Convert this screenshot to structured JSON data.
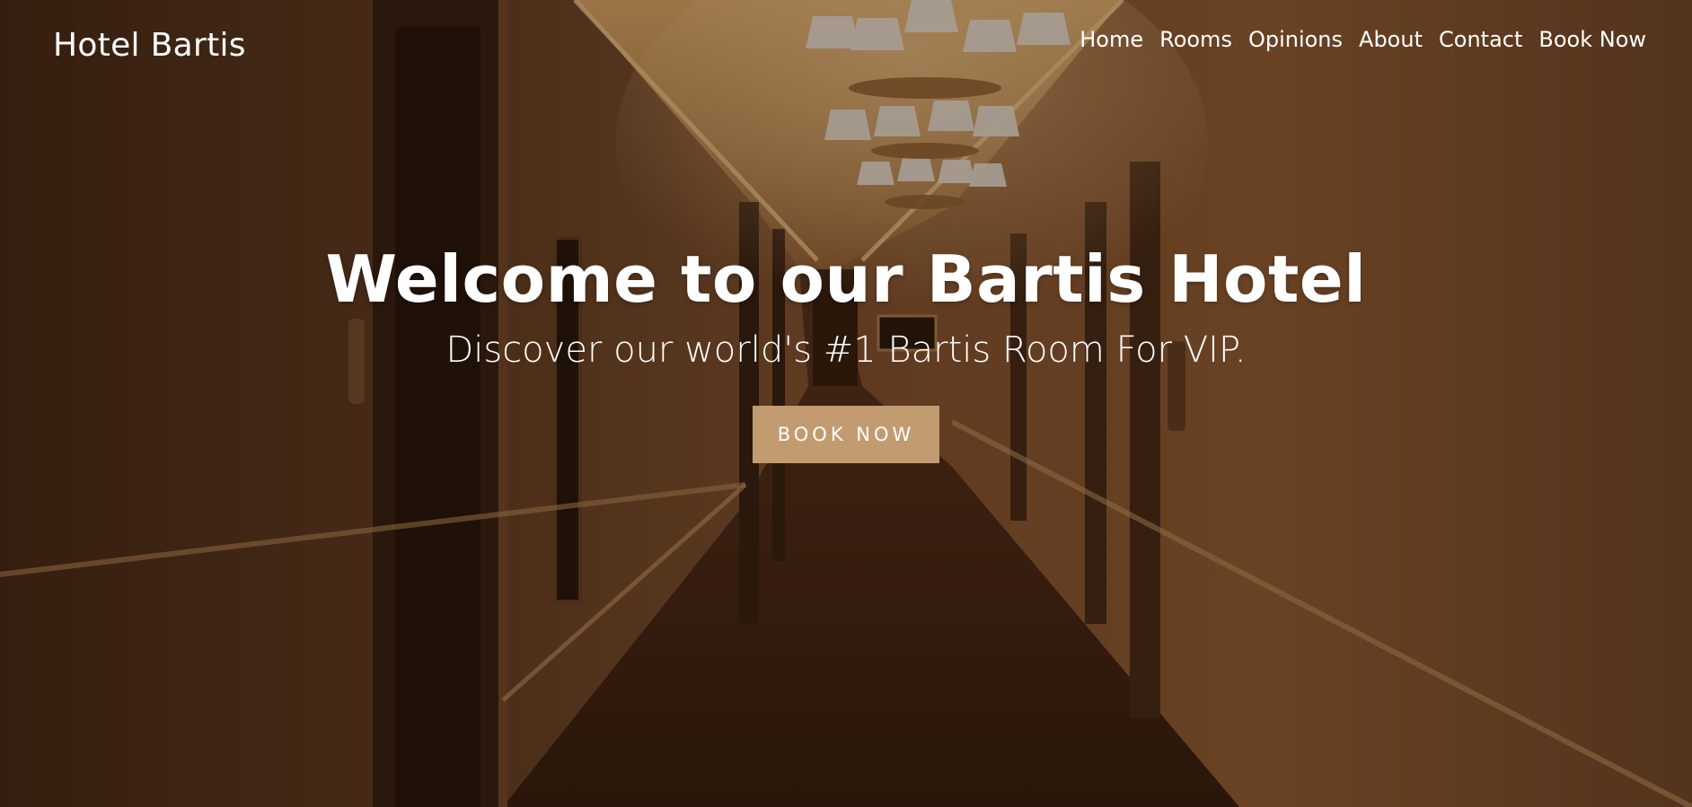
{
  "site": {
    "brand": "Hotel Bartis"
  },
  "nav": {
    "items": [
      {
        "label": "Home"
      },
      {
        "label": "Rooms"
      },
      {
        "label": "Opinions"
      },
      {
        "label": "About"
      },
      {
        "label": "Contact"
      },
      {
        "label": "Book Now"
      }
    ]
  },
  "hero": {
    "title": "Welcome to our Bartis Hotel",
    "subtitle": "Discover our world's #1 Bartis Room For VIP.",
    "cta_label": "BOOK NOW"
  },
  "colors": {
    "accent": "#c29c70",
    "text": "#ffffff",
    "overlay": "#3a2213"
  }
}
